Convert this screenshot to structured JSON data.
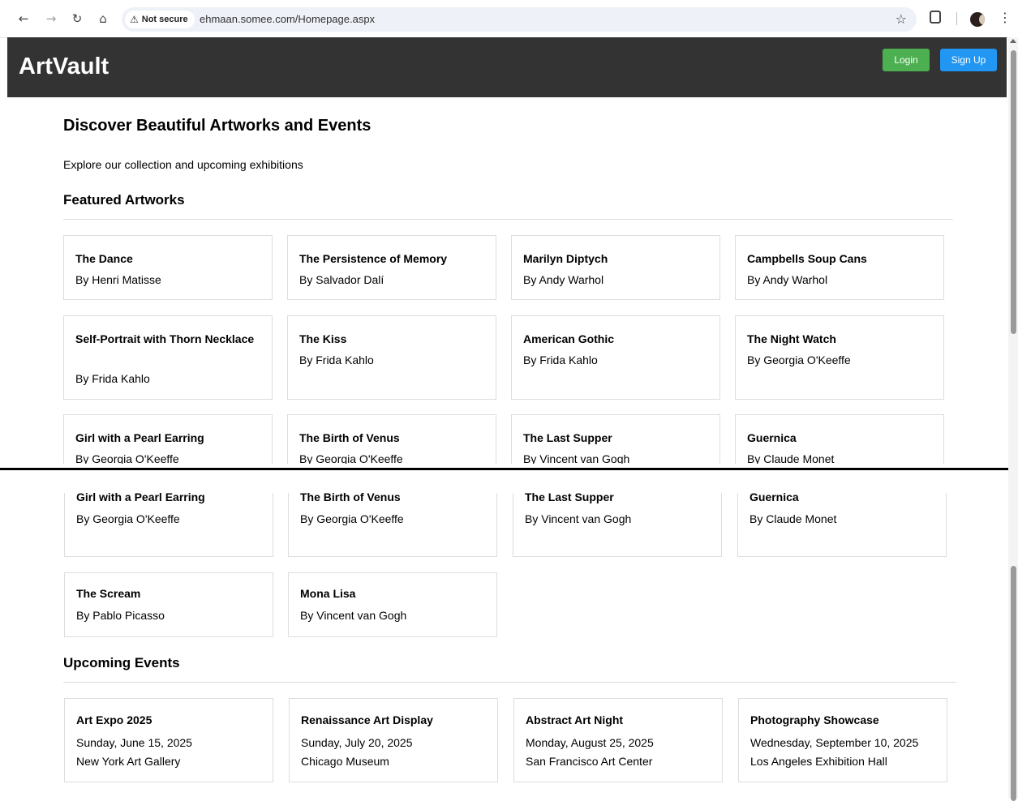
{
  "browser": {
    "security_label": "Not secure",
    "url": "ehmaan.somee.com/Homepage.aspx"
  },
  "header": {
    "brand": "ArtVault",
    "login_label": "Login",
    "signup_label": "Sign Up"
  },
  "hero": {
    "title": "Discover Beautiful Artworks and Events",
    "subtitle": "Explore our collection and upcoming exhibitions"
  },
  "featured": {
    "heading": "Featured Artworks",
    "artworks": [
      {
        "title": "The Dance",
        "artist": "By Henri Matisse"
      },
      {
        "title": "The Persistence of Memory",
        "artist": "By Salvador Dalí"
      },
      {
        "title": "Marilyn Diptych",
        "artist": "By Andy Warhol"
      },
      {
        "title": "Campbells Soup Cans",
        "artist": "By Andy Warhol"
      },
      {
        "title": "Self-Portrait with Thorn Necklace",
        "artist": "By Frida Kahlo"
      },
      {
        "title": "The Kiss",
        "artist": "By Frida Kahlo"
      },
      {
        "title": "American Gothic",
        "artist": "By Frida Kahlo"
      },
      {
        "title": "The Night Watch",
        "artist": "By Georgia O'Keeffe"
      },
      {
        "title": "Girl with a Pearl Earring",
        "artist": "By Georgia O'Keeffe"
      },
      {
        "title": "The Birth of Venus",
        "artist": "By Georgia O'Keeffe"
      },
      {
        "title": "The Last Supper",
        "artist": "By Vincent van Gogh"
      },
      {
        "title": "Guernica",
        "artist": "By Claude Monet"
      },
      {
        "title": "The Scream",
        "artist": "By Pablo Picasso"
      },
      {
        "title": "Mona Lisa",
        "artist": "By Vincent van Gogh"
      }
    ]
  },
  "events": {
    "heading": "Upcoming Events",
    "items": [
      {
        "name": "Art Expo 2025",
        "date": "Sunday, June 15, 2025",
        "location": "New York Art Gallery"
      },
      {
        "name": "Renaissance Art Display",
        "date": "Sunday, July 20, 2025",
        "location": "Chicago Museum"
      },
      {
        "name": "Abstract Art Night",
        "date": "Monday, August 25, 2025",
        "location": "San Francisco Art Center"
      },
      {
        "name": "Photography Showcase",
        "date": "Wednesday, September 10, 2025",
        "location": "Los Angeles Exhibition Hall"
      }
    ]
  },
  "colors": {
    "header_bg": "#333333",
    "login_green": "#4caf50",
    "signup_blue": "#2196f3"
  }
}
